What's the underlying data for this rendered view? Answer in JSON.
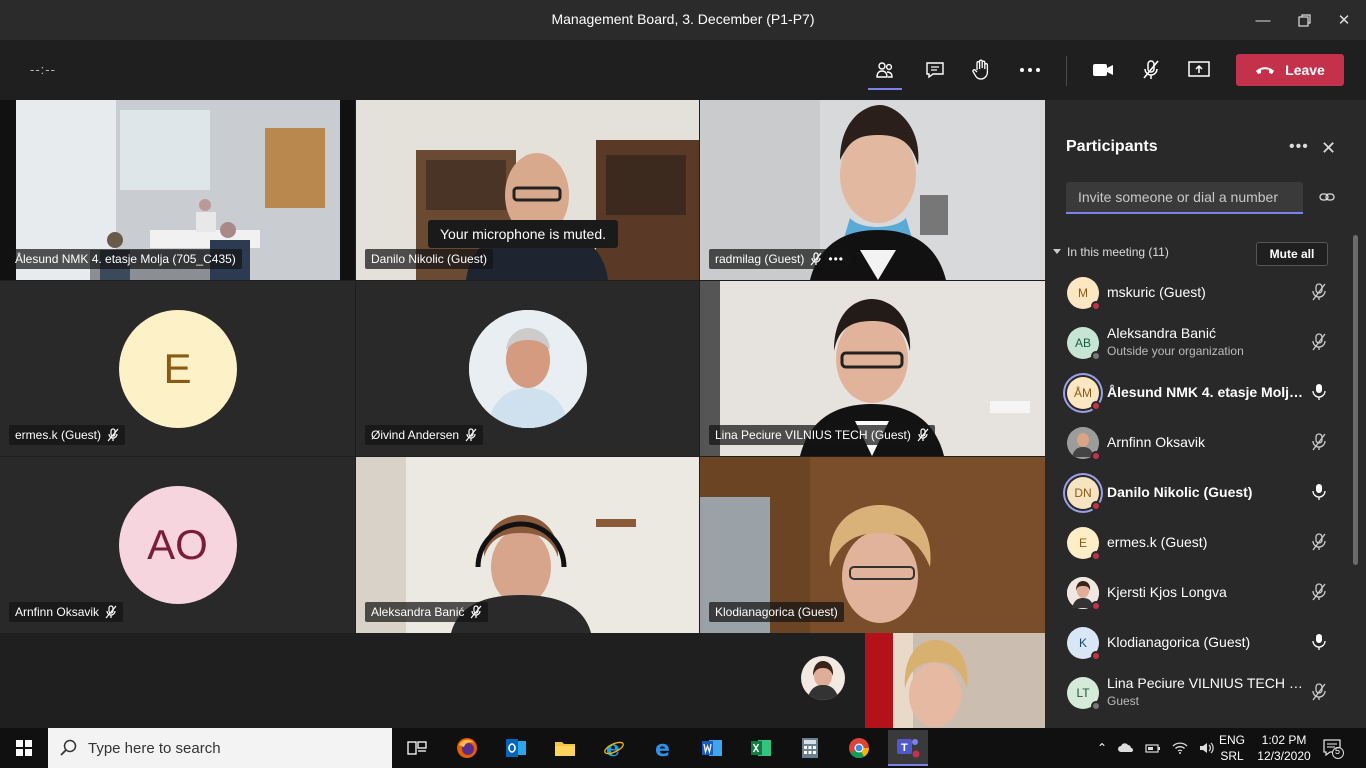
{
  "window": {
    "title": "Management Board, 3. December (P1-P7)"
  },
  "toolbar": {
    "timer": "--:--",
    "leave_label": "Leave"
  },
  "toast": "Your microphone is muted.",
  "tiles": [
    {
      "name": "Ålesund NMK 4. etasje Molja (705_C435)"
    },
    {
      "name": "Danilo Nikolic (Guest)"
    },
    {
      "name": "radmilag (Guest)"
    },
    {
      "name": "ermes.k (Guest)",
      "initials": "E"
    },
    {
      "name": "Øivind Andersen"
    },
    {
      "name": "Lina Peciure VILNIUS TECH (Guest)"
    },
    {
      "name": "Arnfinn Oksavik",
      "initials": "AO"
    },
    {
      "name": "Aleksandra Banić"
    },
    {
      "name": "Klodianagorica (Guest)"
    }
  ],
  "panel": {
    "title": "Participants",
    "invite_placeholder": "Invite someone or dial a number",
    "section": "In this meeting (11)",
    "mute_all": "Mute all",
    "participants": [
      {
        "initials": "M",
        "name": "mskuric (Guest)",
        "sub": "",
        "bg": "#fde7c3",
        "mic": "muted"
      },
      {
        "initials": "AB",
        "name": "Aleksandra Banić",
        "sub": "Outside your organization",
        "bg": "#c6e5d4",
        "mic": "muted"
      },
      {
        "initials": "ÅM",
        "name": "Ålesund NMK 4. etasje Molja...",
        "sub": "",
        "bg": "#fde7c3",
        "mic": "on"
      },
      {
        "initials": "",
        "name": "Arnfinn Oksavik",
        "sub": "",
        "bg": "#8a8a8a",
        "mic": "muted"
      },
      {
        "initials": "DN",
        "name": "Danilo Nikolic (Guest)",
        "sub": "",
        "bg": "#f5e3c2",
        "mic": "on"
      },
      {
        "initials": "E",
        "name": "ermes.k (Guest)",
        "sub": "",
        "bg": "#fdeec8",
        "mic": "muted"
      },
      {
        "initials": "",
        "name": "Kjersti Kjos Longva",
        "sub": "",
        "bg": "#d8a080",
        "mic": "muted"
      },
      {
        "initials": "K",
        "name": "Klodianagorica (Guest)",
        "sub": "",
        "bg": "#d9e6f5",
        "mic": "on"
      },
      {
        "initials": "LT",
        "name": "Lina Peciure VILNIUS TECH (G...",
        "sub": "Guest",
        "bg": "#d5ead9",
        "mic": "muted"
      }
    ]
  },
  "taskbar": {
    "search_placeholder": "Type here to search",
    "lang1": "ENG",
    "lang2": "SRL",
    "time": "1:02 PM",
    "date": "12/3/2020",
    "notif_count": "5"
  },
  "colors": {
    "accent": "#7b83eb",
    "leave": "#c4314b",
    "status_red": "#c4314b"
  }
}
